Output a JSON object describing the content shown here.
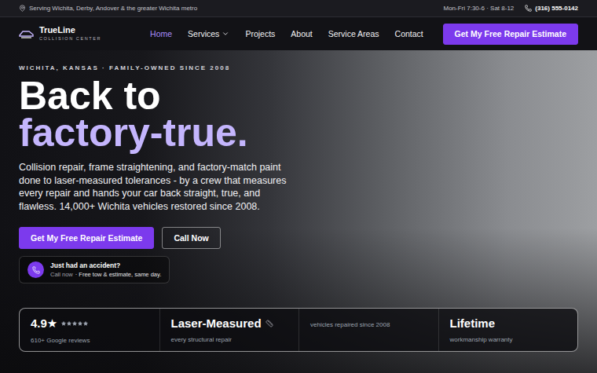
{
  "top_bar": {
    "location": "Serving Wichita, Derby, Andover & the greater Wichita metro",
    "hours": "Mon-Fri 7:30-6 · Sat 8-12",
    "phone": "(316) 555-0142"
  },
  "nav": {
    "logo": {
      "name": "TrueLine",
      "tagline": "COLLISION CENTER"
    },
    "links": [
      {
        "label": "Home",
        "selected": true,
        "dropdown": false
      },
      {
        "label": "Services",
        "selected": false,
        "dropdown": true
      },
      {
        "label": "Projects",
        "selected": false,
        "dropdown": false
      },
      {
        "label": "About",
        "selected": false,
        "dropdown": false
      },
      {
        "label": "Service Areas",
        "selected": false,
        "dropdown": false
      },
      {
        "label": "Contact",
        "selected": false,
        "dropdown": false
      }
    ],
    "cta": "Get My Free Repair Estimate"
  },
  "hero": {
    "eyebrow": "WICHITA, KANSAS · FAMILY-OWNED SINCE 2008",
    "headline": [
      {
        "text": "Back to",
        "accent": false
      },
      {
        "text": "factory-true.",
        "accent": true
      }
    ],
    "body": "Collision repair, frame straightening, and factory-match paint done to laser-measured tolerances - by a crew that measures every repair and hands your car back straight, true, and flawless. 14,000+ Wichita vehicles restored since 2008.",
    "primary_button": "Get My Free Repair Estimate",
    "secondary_button": "Call Now",
    "callout": {
      "title": "Just had an accident?",
      "lead": "Call now",
      "detail": "· Free tow & estimate, same day."
    }
  },
  "stats": [
    {
      "kind": "rating",
      "value": "4.9★",
      "stars": 5,
      "label": "610+ Google reviews"
    },
    {
      "kind": "measure",
      "value": "Laser-Measured",
      "label": "every structural repair"
    },
    {
      "kind": "counter",
      "label": "vehicles repaired since 2008"
    },
    {
      "kind": "text",
      "value": "Lifetime",
      "label": "workmanship warranty"
    }
  ]
}
